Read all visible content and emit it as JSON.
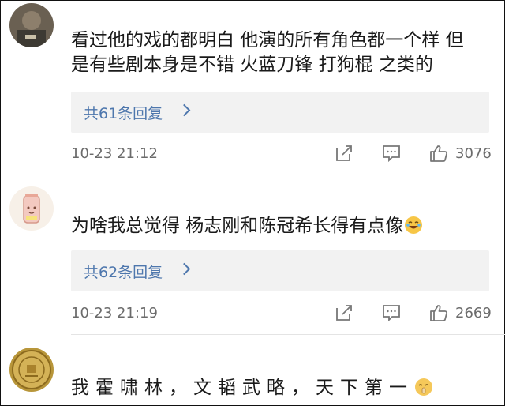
{
  "comments": [
    {
      "text_line1": "看过他的戏的都明白 他演的所有角色都一个样 但",
      "text_line2": "是有些剧本身是不错 火蓝刀锋 打狗棍 之类的",
      "replies_label": "共61条回复",
      "time": "10-23 21:12",
      "likes": "3076"
    },
    {
      "text": "为啥我总觉得 杨志刚和陈冠希长得有点像",
      "replies_label": "共62条回复",
      "time": "10-23 21:19",
      "likes": "2669"
    },
    {
      "text": "我霍啸林，文韬武略，天下第一"
    }
  ],
  "icons": [
    "share-icon",
    "comment-icon",
    "like-icon",
    "laugh-cry-emoji",
    "shush-emoji"
  ],
  "colors": {
    "link": "#4e77ad",
    "meta": "#6b6b6b",
    "reply_bg": "#f2f2f2"
  }
}
